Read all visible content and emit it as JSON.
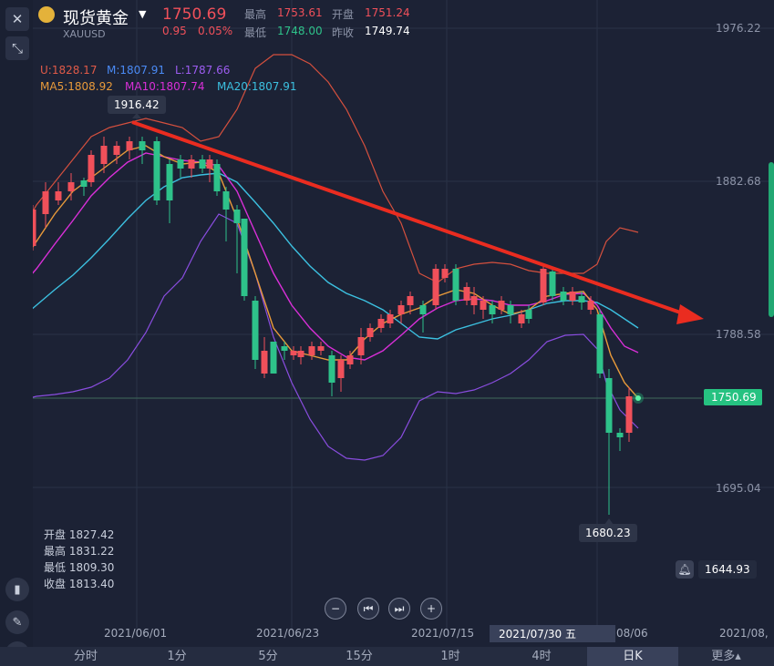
{
  "header": {
    "name": "现货黄金",
    "symbol": "XAUUSD",
    "price": "1750.69",
    "change": "0.95",
    "change_pct": "0.05%",
    "high_label": "最高",
    "high": "1753.61",
    "open_label": "开盘",
    "open": "1751.24",
    "low_label": "最低",
    "low": "1748.00",
    "prev_label": "昨收",
    "prev": "1749.74"
  },
  "indicators": {
    "u": "U:1828.17",
    "m": "M:1807.91",
    "l": "L:1787.66",
    "ma5": "MA5:1808.92",
    "ma10": "MA10:1807.74",
    "ma20": "MA20:1807.91"
  },
  "price_axis": [
    "1976.22",
    "1882.68",
    "1788.58",
    "1695.04"
  ],
  "current_price_tag": "1750.69",
  "alert_price": "1644.93",
  "high_marker": "1916.42",
  "low_marker": "1680.23",
  "ohlc": {
    "open": "开盘 1827.42",
    "high": "最高 1831.22",
    "low": "最低 1809.30",
    "close": "收盘 1813.40"
  },
  "dates": [
    "2021/06/01",
    "2021/06/23",
    "2021/07/15",
    "2021/07/30 五",
    "08/06",
    "2021/08,"
  ],
  "timeframes": [
    "分时",
    "1分",
    "5分",
    "15分",
    "1时",
    "4时",
    "日K",
    "更多▴"
  ],
  "active_timeframe": "日K",
  "colors": {
    "up": "#f0505a",
    "down": "#2ec28a",
    "bg": "#1c2235",
    "accent": "#26c281"
  },
  "icons": [
    "close-icon",
    "collapse-icon",
    "candle-style-icon",
    "pen-icon",
    "indicator-icon",
    "zoom-out-icon",
    "prev-icon",
    "next-icon",
    "zoom-in-icon",
    "bell-icon"
  ]
}
